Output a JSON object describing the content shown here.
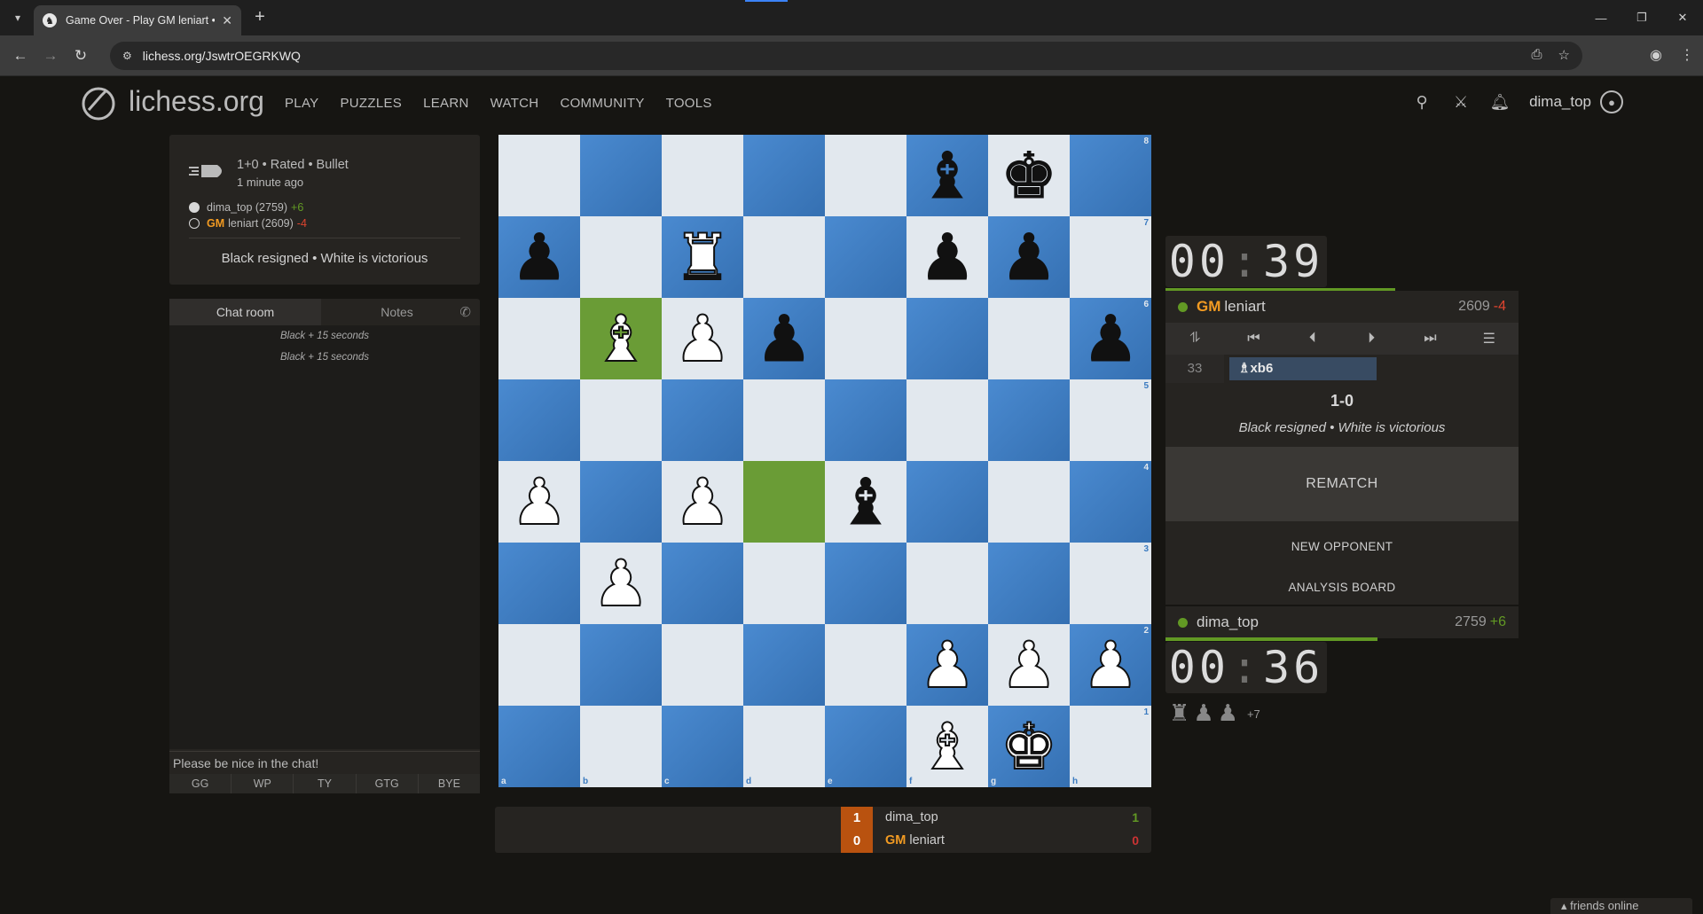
{
  "browser": {
    "tab_title": "Game Over - Play GM leniart • lichess.org",
    "url": "lichess.org/JswtrOEGRKWQ"
  },
  "header": {
    "logo_text": "lichess.org",
    "nav": [
      "PLAY",
      "PUZZLES",
      "LEARN",
      "WATCH",
      "COMMUNITY",
      "TOOLS"
    ],
    "username": "dima_top"
  },
  "game_info": {
    "setup": "1+0 • Rated • Bullet",
    "ago": "1 minute ago",
    "white_player": "dima_top (2759)",
    "white_diff": "+6",
    "black_title": "GM",
    "black_player": "leniart (2609)",
    "black_diff": "-4",
    "result": "Black resigned • White is victorious"
  },
  "chat": {
    "tabs": [
      "Chat room",
      "Notes"
    ],
    "messages": [
      "Black + 15 seconds",
      "Black + 15 seconds"
    ],
    "placeholder": "Please be nice in the chat!",
    "presets": [
      "GG",
      "WP",
      "TY",
      "GTG",
      "BYE"
    ]
  },
  "board": {
    "ranks": [
      "8",
      "7",
      "6",
      "5",
      "4",
      "3",
      "2",
      "1"
    ],
    "files": [
      "a",
      "b",
      "c",
      "d",
      "e",
      "f",
      "g",
      "h"
    ],
    "position": [
      [
        "",
        "",
        "",
        "",
        "",
        "b",
        "k",
        ""
      ],
      [
        "p",
        "",
        "R",
        "",
        "",
        "p",
        "p",
        ""
      ],
      [
        "",
        "B",
        "P",
        "p",
        "",
        "",
        "",
        "p"
      ],
      [
        "",
        "",
        "",
        "",
        "",
        "",
        "",
        ""
      ],
      [
        "P",
        "",
        "P",
        "",
        "b",
        "",
        "",
        ""
      ],
      [
        "",
        "P",
        "",
        "",
        "",
        "",
        "",
        ""
      ],
      [
        "",
        "",
        "",
        "",
        "",
        "P",
        "P",
        "P"
      ],
      [
        "",
        "",
        "",
        "",
        "",
        "B",
        "K",
        ""
      ]
    ],
    "highlight": [
      "b6",
      "d4"
    ]
  },
  "crosstable": [
    {
      "score": "1",
      "name": "dima_top",
      "title": "",
      "points": "1",
      "result": "win"
    },
    {
      "score": "0",
      "name": "leniart",
      "title": "GM",
      "points": "0",
      "result": "loss"
    }
  ],
  "opponent": {
    "clock_min": "00",
    "clock_sec": "39",
    "title": "GM",
    "name": "leniart",
    "rating": "2609",
    "diff": "-4",
    "clock_fraction": 0.65
  },
  "player": {
    "clock_min": "00",
    "clock_sec": "36",
    "name": "dima_top",
    "rating": "2759",
    "diff": "+6",
    "clock_fraction": 0.6
  },
  "moves": {
    "number": "33",
    "san": "♗xb6",
    "score": "1-0",
    "status": "Black resigned • White is victorious",
    "rematch": "REMATCH",
    "new_opponent": "NEW OPPONENT",
    "analysis": "ANALYSIS BOARD"
  },
  "material": {
    "pieces": [
      "♜",
      "♟",
      "♟"
    ],
    "diff": "+7"
  },
  "friends": "friends online"
}
